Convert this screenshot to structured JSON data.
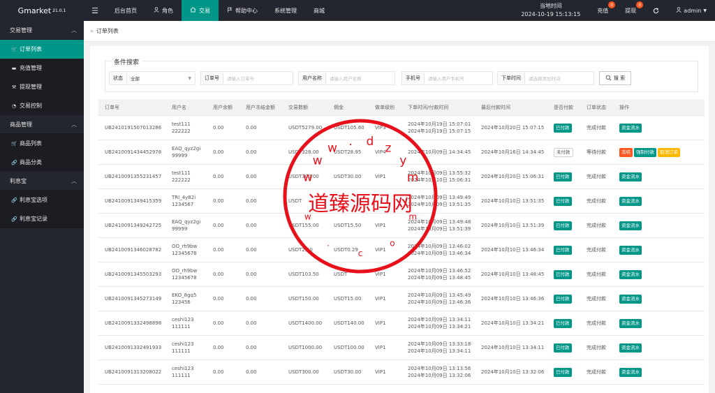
{
  "brand": {
    "name": "Gmarket",
    "version": "21.0.1"
  },
  "topnav": [
    {
      "label": "后台首页",
      "icon": ""
    },
    {
      "label": "角色",
      "icon": "user-icon"
    },
    {
      "label": "交易",
      "icon": "trade-icon",
      "active": true
    },
    {
      "label": "帮助中心",
      "icon": "flag-icon"
    },
    {
      "label": "系统管理",
      "icon": ""
    },
    {
      "label": "商城",
      "icon": ""
    }
  ],
  "clock": {
    "label": "当地时间",
    "value": "2024-10-19 15:13:15"
  },
  "top_right": {
    "recharge": "充值",
    "recharge_badge": "0",
    "withdraw": "提现",
    "withdraw_badge": "0",
    "user": "admin"
  },
  "sidebar": [
    {
      "type": "group",
      "label": "交易管理"
    },
    {
      "type": "item",
      "label": "订单列表",
      "icon": "cart-icon",
      "active": true
    },
    {
      "type": "item",
      "label": "充值管理",
      "icon": "card-icon"
    },
    {
      "type": "item",
      "label": "提现管理",
      "icon": "gavel-icon"
    },
    {
      "type": "item",
      "label": "交易控制",
      "icon": "dashboard-icon"
    },
    {
      "type": "group",
      "label": "商品管理"
    },
    {
      "type": "item",
      "label": "商品列表",
      "icon": "cart-icon"
    },
    {
      "type": "item",
      "label": "商品分类",
      "icon": "link-icon"
    },
    {
      "type": "group",
      "label": "利息宝"
    },
    {
      "type": "item",
      "label": "利息宝选项",
      "icon": "link-icon"
    },
    {
      "type": "item",
      "label": "利息宝记录",
      "icon": "link-icon"
    }
  ],
  "breadcrumb": "订单列表",
  "search": {
    "legend": "条件搜索",
    "status_label": "状态",
    "status_value": "全部",
    "order_label": "订单号",
    "order_placeholder": "请输入订单号",
    "user_label": "用户名称",
    "user_placeholder": "请输入用户名称",
    "phone_label": "手机号",
    "phone_placeholder": "请输入用户手机号",
    "time_label": "下单时间",
    "time_placeholder": "请选择添加时间",
    "button": "搜 索"
  },
  "table": {
    "headers": [
      "订单号",
      "用户名",
      "用户余额",
      "用户冻结金额",
      "交易数额",
      "佣金",
      "做单级别",
      "下单时间/付款时间",
      "最后付款时间",
      "是否付款",
      "订单状态",
      "操作"
    ],
    "rows": [
      {
        "order": "UB2410191507013286",
        "user1": "test111",
        "user2": "222222",
        "balance": "0.00",
        "frozen": "0.00",
        "amount": "USDT5279.00",
        "commission": "USDT105.60",
        "level": "VIP3",
        "t1": "2024年10月19日 15:07:01",
        "t2": "2024年10月19日 15:07:15",
        "last": "2024年10月20日 15:07:15",
        "paid": "已付款",
        "paid_state": "paid",
        "status": "完成付款",
        "actions": [
          "资金流水"
        ]
      },
      {
        "order": "UB2410091434452978",
        "user1": "EAQ_qyz2gi",
        "user2": "99999",
        "balance": "0.00",
        "frozen": "0.00",
        "amount": "USDT328.00",
        "commission": "USDT28.95",
        "level": "VIP4",
        "t1": "2024年10月09日 14:34:45",
        "t2": "",
        "last": "2024年10月16日 14:34:45",
        "paid": "未付款",
        "paid_state": "unpaid",
        "status": "等待付款",
        "actions": [
          "冻结",
          "强制付款",
          "取消订单"
        ]
      },
      {
        "order": "UB2410091355231457",
        "user1": "test111",
        "user2": "222222",
        "balance": "0.00",
        "frozen": "0.00",
        "amount": "USDT300.00",
        "commission": "USDT30.00",
        "level": "VIP1",
        "t1": "2024年10月09日 13:55:32",
        "t2": "2024年10月10日 15:06:31",
        "last": "2024年10月20日 15:06:31",
        "paid": "已付款",
        "paid_state": "paid",
        "status": "完成付款",
        "actions": [
          "资金流水"
        ]
      },
      {
        "order": "UB2410091349415359",
        "user1": "TRI_4y82i",
        "user2": "1234567",
        "balance": "0.00",
        "frozen": "0.00",
        "amount": "USDT",
        "commission": "",
        "level": "",
        "t1": "2024年10月09日 13:49:49",
        "t2": "2024年10月09日 13:51:35",
        "last": "2024年10月10日 13:51:35",
        "paid": "已付款",
        "paid_state": "paid",
        "status": "完成付款",
        "actions": [
          "资金流水"
        ]
      },
      {
        "order": "UB2410091349242725",
        "user1": "EAQ_qyz2gi",
        "user2": "99999",
        "balance": "0.00",
        "frozen": "0.00",
        "amount": "USDT155.00",
        "commission": "USDT15.50",
        "level": "VIP1",
        "t1": "2024年10月09日 13:49:48",
        "t2": "2024年10月09日 13:51:39",
        "last": "2024年10月10日 13:51:39",
        "paid": "已付款",
        "paid_state": "paid",
        "status": "完成付款",
        "actions": [
          "资金流水"
        ]
      },
      {
        "order": "UB2410091346028782",
        "user1": "OO_rh9bw",
        "user2": "12345678",
        "balance": "0.00",
        "frozen": "0.00",
        "amount": "USDT2.50",
        "commission": "USDT0.29",
        "level": "VIP1",
        "t1": "2024年10月09日 13:46:02",
        "t2": "2024年10月09日 13:46:34",
        "last": "2024年10月10日 13:46:34",
        "paid": "已付款",
        "paid_state": "paid",
        "status": "完成付款",
        "actions": [
          "资金流水"
        ]
      },
      {
        "order": "UB2410091345503293",
        "user1": "OO_rh9bw",
        "user2": "12345678",
        "balance": "0.00",
        "frozen": "0.00",
        "amount": "USDT103.50",
        "commission": "USDT",
        "level": "VIP1",
        "t1": "2024年10月09日 13:46:52",
        "t2": "2024年10月09日 13:48:45",
        "last": "2024年10月10日 13:48:45",
        "paid": "已付款",
        "paid_state": "paid",
        "status": "完成付款",
        "actions": [
          "资金流水"
        ]
      },
      {
        "order": "UB2410091345273149",
        "user1": "EKO_8gq5",
        "user2": "123456",
        "balance": "0.00",
        "frozen": "0.00",
        "amount": "USDT150.00",
        "commission": "USDT15.00",
        "level": "VIP1",
        "t1": "2024年10月09日 13:45:49",
        "t2": "2024年10月09日 13:46:36",
        "last": "2024年10月10日 13:46:36",
        "paid": "已付款",
        "paid_state": "paid",
        "status": "完成付款",
        "actions": [
          "资金流水"
        ]
      },
      {
        "order": "UB2410091332498898",
        "user1": "ceshi123",
        "user2": "111111",
        "balance": "0.00",
        "frozen": "0.00",
        "amount": "USDT1400.00",
        "commission": "USDT140.00",
        "level": "VIP1",
        "t1": "2024年10月09日 13:34:11",
        "t2": "2024年10月09日 13:34:21",
        "last": "2024年10月10日 13:34:21",
        "paid": "已付款",
        "paid_state": "paid",
        "status": "完成付款",
        "actions": [
          "资金流水"
        ]
      },
      {
        "order": "UB2410091332491933",
        "user1": "ceshi123",
        "user2": "111111",
        "balance": "0.00",
        "frozen": "0.00",
        "amount": "USDT1000.00",
        "commission": "USDT100.00",
        "level": "VIP1",
        "t1": "2024年10月09日 13:33:18",
        "t2": "2024年10月09日 13:34:11",
        "last": "2024年10月10日 13:34:11",
        "paid": "已付款",
        "paid_state": "paid",
        "status": "完成付款",
        "actions": [
          "资金流水"
        ]
      },
      {
        "order": "UB2410091313208022",
        "user1": "ceshi123",
        "user2": "111111",
        "balance": "0.00",
        "frozen": "0.00",
        "amount": "USDT300.00",
        "commission": "USDT30.00",
        "level": "VIP1",
        "t1": "2024年10月09日 13:13:56",
        "t2": "2024年10月09日 13:32:06",
        "last": "2024年10月10日 13:32:06",
        "paid": "已付款",
        "paid_state": "paid",
        "status": "完成付款",
        "actions": [
          "资金流水"
        ]
      }
    ]
  },
  "watermark": {
    "text": "道臻源码网",
    "url_chars": [
      "w",
      "w",
      "w",
      ".",
      "d",
      "z",
      "y",
      "m",
      "w",
      ".",
      "c",
      "o",
      "m"
    ],
    "color": "#e8101a"
  }
}
